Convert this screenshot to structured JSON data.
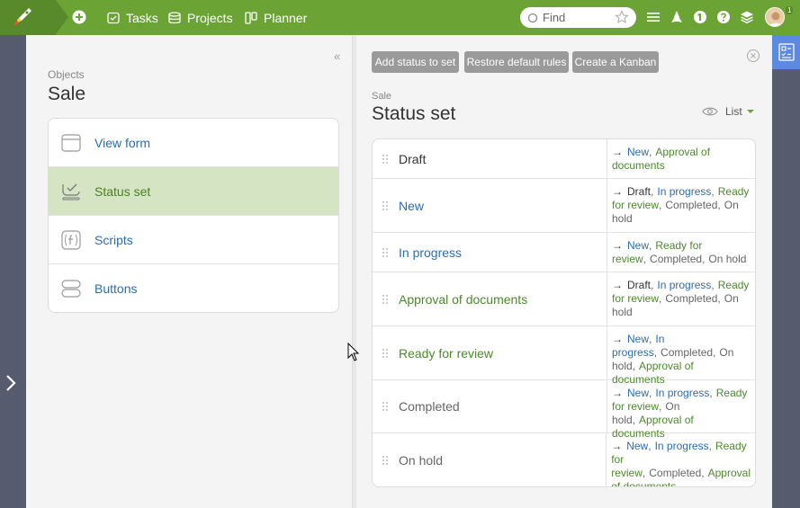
{
  "topbar": {
    "nav": [
      {
        "label": "Tasks",
        "icon": "tasks-icon"
      },
      {
        "label": "Projects",
        "icon": "projects-icon"
      },
      {
        "label": "Planner",
        "icon": "planner-icon"
      }
    ],
    "search_placeholder": "Find",
    "notifications_count": "1"
  },
  "left": {
    "object_label": "Objects",
    "object_title": "Sale",
    "menu": [
      {
        "label": "View form",
        "icon": "view-form-icon"
      },
      {
        "label": "Status set",
        "icon": "status-set-icon"
      },
      {
        "label": "Scripts",
        "icon": "scripts-icon"
      },
      {
        "label": "Buttons",
        "icon": "buttons-icon"
      }
    ]
  },
  "right": {
    "buttons": [
      "Add status to set",
      "Restore default rules",
      "Create a Kanban"
    ],
    "section_label": "Sale",
    "section_title": "Status set",
    "view_label": "List",
    "rows": [
      {
        "name": "Draft",
        "transitions": [
          "New",
          "Approval of documents"
        ]
      },
      {
        "name": "New",
        "transitions": [
          "Draft",
          "In progress",
          "Ready for review",
          "Completed",
          "On hold"
        ]
      },
      {
        "name": "In progress",
        "transitions": [
          "New",
          "Ready for review",
          "Completed",
          "On hold"
        ]
      },
      {
        "name": "Approval of documents",
        "transitions": [
          "Draft",
          "In progress",
          "Ready for review",
          "Completed",
          "On hold"
        ]
      },
      {
        "name": "Ready for review",
        "transitions": [
          "New",
          "In progress",
          "Completed",
          "On hold",
          "Approval of documents"
        ]
      },
      {
        "name": "Completed",
        "transitions": [
          "New",
          "In progress",
          "Ready for review",
          "On hold",
          "Approval of documents"
        ]
      },
      {
        "name": "On hold",
        "transitions": [
          "New",
          "In progress",
          "Ready for review",
          "Completed",
          "Approval of documents"
        ]
      }
    ]
  },
  "colors": {
    "topbar": "#6ba334",
    "accent_blue": "#2a6db3",
    "accent_green": "#4c8a2a",
    "active_menu_bg": "#d5e4c3",
    "right_tab": "#5c8ae0"
  }
}
